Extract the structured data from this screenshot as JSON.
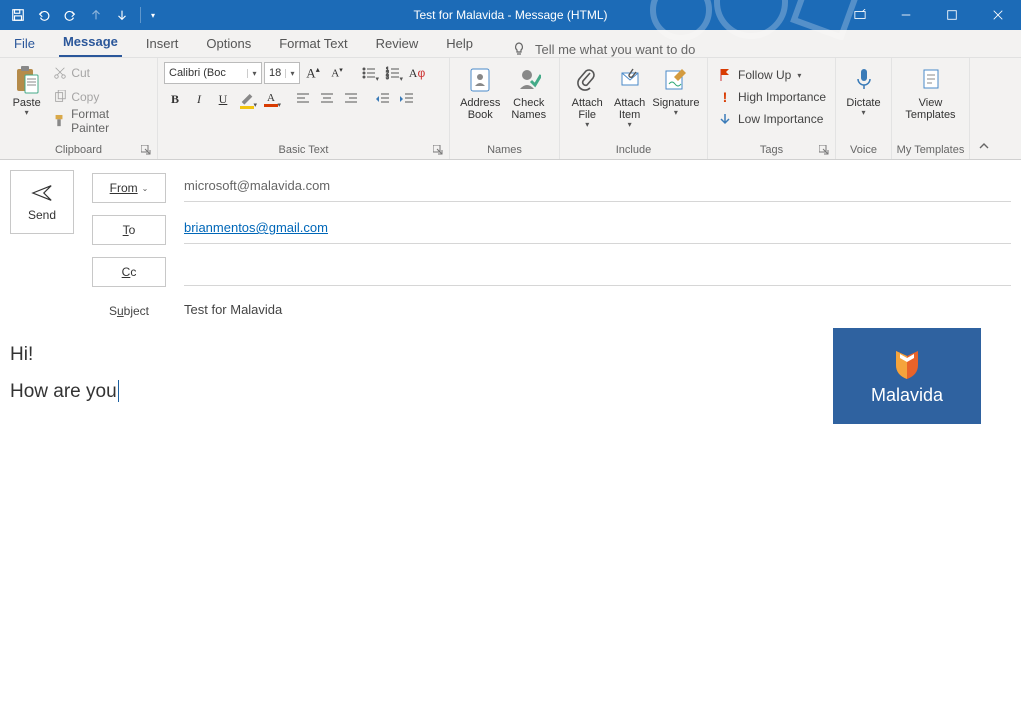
{
  "titlebar": {
    "title": "Test for Malavida  -  Message (HTML)",
    "qat": {
      "save": "save-icon",
      "undo": "undo-icon",
      "redo": "redo-icon",
      "prev": "up-arrow-icon",
      "next": "down-arrow-icon"
    }
  },
  "tabs": {
    "file": "File",
    "message": "Message",
    "insert": "Insert",
    "options": "Options",
    "format_text": "Format Text",
    "review": "Review",
    "help": "Help",
    "tell_me": "Tell me what you want to do"
  },
  "ribbon": {
    "clipboard": {
      "label": "Clipboard",
      "paste": "Paste",
      "cut": "Cut",
      "copy": "Copy",
      "format_painter": "Format Painter"
    },
    "basic_text": {
      "label": "Basic Text",
      "font_name": "Calibri (Boc",
      "font_size": "18"
    },
    "names": {
      "label": "Names",
      "address_book": "Address\nBook",
      "check_names": "Check\nNames"
    },
    "include": {
      "label": "Include",
      "attach_file": "Attach\nFile",
      "attach_item": "Attach\nItem",
      "signature": "Signature"
    },
    "tags": {
      "label": "Tags",
      "follow_up": "Follow Up",
      "high": "High Importance",
      "low": "Low Importance"
    },
    "voice": {
      "label": "Voice",
      "dictate": "Dictate"
    },
    "templates": {
      "label": "My Templates",
      "view": "View\nTemplates"
    }
  },
  "compose": {
    "send": "Send",
    "from_label": "From",
    "from_value": "microsoft@malavida.com",
    "to_label": "To",
    "to_value": "brianmentos@gmail.com",
    "cc_label": "Cc",
    "cc_value": "",
    "subject_label": "Subject",
    "subject_value": "Test for Malavida"
  },
  "body": {
    "line1": "Hi!",
    "line2": "How are you",
    "logo_text": "Malavida"
  }
}
